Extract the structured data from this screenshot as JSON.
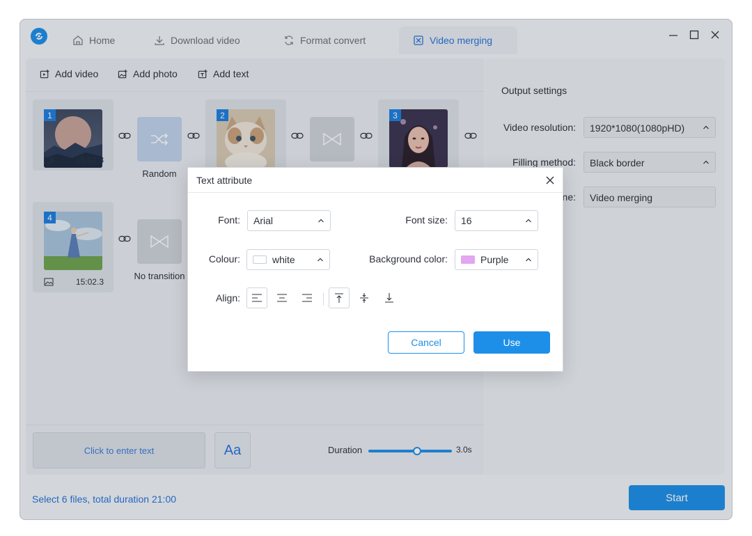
{
  "tabs": [
    {
      "label": "Home",
      "icon": "home-icon"
    },
    {
      "label": "Download video",
      "icon": "download-icon"
    },
    {
      "label": "Format convert",
      "icon": "refresh-icon"
    },
    {
      "label": "Video merging",
      "icon": "merge-icon",
      "active": true
    }
  ],
  "toolbar": {
    "add_video": "Add video",
    "add_photo": "Add photo",
    "add_text": "Add text"
  },
  "clips": [
    {
      "index": "1",
      "duration": "15:02.3",
      "type": "video"
    },
    {
      "index": "2",
      "type": "photo"
    },
    {
      "index": "3",
      "type": "photo"
    },
    {
      "index": "4",
      "duration": "15:02.3",
      "type": "photo"
    }
  ],
  "transitions": {
    "random": "Random",
    "none": "No transition"
  },
  "bottom": {
    "text_placeholder": "Click to enter text",
    "font_button": "Aa",
    "duration_label": "Duration",
    "duration_value": "3.0s",
    "duration_fraction": 0.58
  },
  "output": {
    "title": "Output settings",
    "resolution_label": "Video resolution:",
    "resolution_value": "1920*1080(1080pHD)",
    "filling_label": "Filling method:",
    "filling_value": "Black border",
    "name_label_partial": "ne:",
    "name_value": "Video merging"
  },
  "status": {
    "summary": "Select 6 files, total duration 21:00",
    "start": "Start"
  },
  "dialog": {
    "title": "Text attribute",
    "font_label": "Font:",
    "font_value": "Arial",
    "font_size_label": "Font size:",
    "font_size_value": "16",
    "colour_label": "Colour:",
    "colour_value": "white",
    "bg_label": "Background color:",
    "bg_value": "Purple",
    "align_label": "Align:",
    "cancel": "Cancel",
    "use": "Use"
  },
  "colors": {
    "accent": "#1d8fe8",
    "purple_swatch": "#e3a6f0",
    "white_swatch": "#ffffff"
  }
}
